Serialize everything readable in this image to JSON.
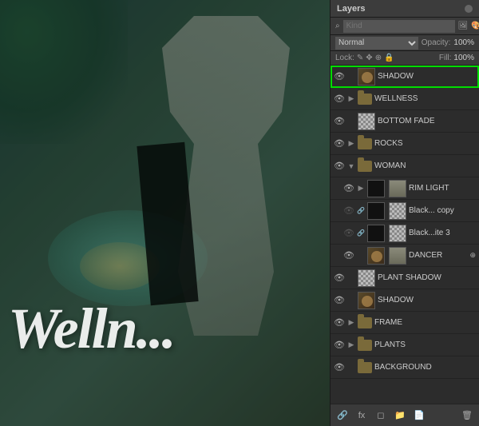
{
  "panel": {
    "title": "Layers",
    "close_icon": "×",
    "search_placeholder": "Kind",
    "blend_mode": "Normal",
    "opacity_label": "Opacity:",
    "opacity_value": "100%",
    "fill_label": "Fill:",
    "fill_value": "100%",
    "lock_label": "Lock:",
    "lock_icons": [
      "✎",
      "↔",
      "↕",
      "🔒"
    ]
  },
  "layers": [
    {
      "id": "shadow-top",
      "name": "SHADOW",
      "type": "image",
      "visible": true,
      "selected": true,
      "highlighted": true,
      "indent": 0,
      "thumb": "shadow",
      "expand": false
    },
    {
      "id": "wellness",
      "name": "WELLNESS",
      "type": "folder",
      "visible": true,
      "selected": false,
      "highlighted": false,
      "indent": 0,
      "thumb": "folder",
      "expand": true,
      "folder_color": "normal"
    },
    {
      "id": "bottom-fade",
      "name": "BOTTOM FADE",
      "type": "image",
      "visible": true,
      "selected": false,
      "highlighted": false,
      "indent": 0,
      "thumb": "gradient",
      "expand": false
    },
    {
      "id": "rocks",
      "name": "ROCKS",
      "type": "folder",
      "visible": true,
      "selected": false,
      "indent": 0,
      "expand": true,
      "folder_color": "normal"
    },
    {
      "id": "woman",
      "name": "WOMAN",
      "type": "folder",
      "visible": true,
      "selected": false,
      "indent": 0,
      "expand": true,
      "folder_color": "normal",
      "open": true
    },
    {
      "id": "rim-light",
      "name": "RIM LIGHT",
      "type": "image",
      "visible": true,
      "selected": false,
      "indent": 1,
      "thumb": "dark",
      "expand": false,
      "has_mask": true
    },
    {
      "id": "black-copy",
      "name": "Black... copy",
      "type": "image",
      "visible": false,
      "selected": false,
      "indent": 1,
      "thumb": "dark",
      "expand": false,
      "has_mask": true,
      "has_fx": true
    },
    {
      "id": "black-ite3",
      "name": "Black...ite 3",
      "type": "image",
      "visible": false,
      "selected": false,
      "indent": 1,
      "thumb": "dark",
      "expand": false,
      "has_mask": true,
      "has_fx": true
    },
    {
      "id": "dancer",
      "name": "DANCER",
      "type": "image",
      "visible": true,
      "selected": false,
      "indent": 1,
      "thumb": "woman",
      "expand": false,
      "has_link": false
    },
    {
      "id": "plant-shadow",
      "name": "PLANT SHADOW",
      "type": "image",
      "visible": true,
      "selected": false,
      "indent": 0,
      "thumb": "checker",
      "expand": false
    },
    {
      "id": "shadow-bottom",
      "name": "SHADOW",
      "type": "image",
      "visible": true,
      "selected": false,
      "indent": 0,
      "thumb": "shadow",
      "expand": false
    },
    {
      "id": "frame",
      "name": "FRAME",
      "type": "folder",
      "visible": true,
      "selected": false,
      "indent": 0,
      "expand": true,
      "folder_color": "normal"
    },
    {
      "id": "plants",
      "name": "PLANTS",
      "type": "folder",
      "visible": true,
      "selected": false,
      "indent": 0,
      "expand": true,
      "folder_color": "normal"
    },
    {
      "id": "background",
      "name": "BACKGROUND",
      "type": "folder",
      "visible": true,
      "selected": false,
      "indent": 0,
      "expand": false,
      "folder_color": "normal"
    }
  ],
  "footer": {
    "icons": [
      "🔗",
      "fx",
      "◻",
      "📁",
      "🗑"
    ]
  },
  "canvas": {
    "wellness_text": "Welln..."
  }
}
